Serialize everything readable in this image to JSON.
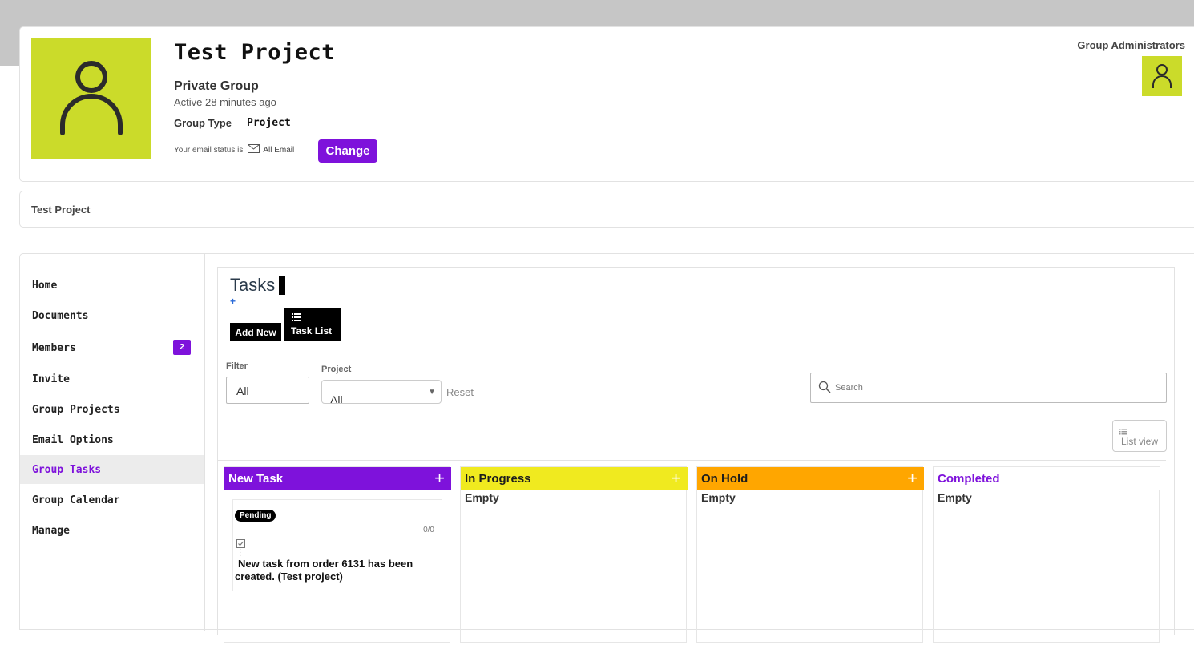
{
  "group": {
    "name": "Test Project",
    "privacy": "Private Group",
    "activity": "Active 28 minutes ago",
    "type_label": "Group Type",
    "type_value": "Project",
    "email_status_prefix": "Your email status is",
    "email_status_value": "All Email",
    "change_label": "Change",
    "admins_label": "Group Administrators"
  },
  "breadcrumb": {
    "current": "Test Project"
  },
  "sidebar": {
    "items": [
      {
        "label": "Home"
      },
      {
        "label": "Documents"
      },
      {
        "label": "Members",
        "badge": "2"
      },
      {
        "label": "Invite"
      },
      {
        "label": "Group Projects"
      },
      {
        "label": "Email Options"
      },
      {
        "label": "Group Tasks",
        "active": true
      },
      {
        "label": "Group Calendar"
      },
      {
        "label": "Manage"
      }
    ]
  },
  "tasks": {
    "title": "Tasks",
    "plus_glyph": "+",
    "add_new_label": "Add New",
    "task_list_label": "Task List",
    "filter_label": "Filter",
    "filter_value": "All",
    "project_label": "Project",
    "project_value": "All",
    "reset_label": "Reset",
    "search_placeholder": "Search",
    "list_view_label": "List view"
  },
  "board": {
    "columns": [
      {
        "title": "New Task",
        "color": "#7e12db",
        "text_color": "#ffffff",
        "plus": "+"
      },
      {
        "title": "In Progress",
        "color": "#f0ea1f",
        "text_color": "#1d1d1d",
        "plus": "+",
        "empty": "Empty"
      },
      {
        "title": "On Hold",
        "color": "#ffa600",
        "text_color": "#1d1d1d",
        "plus": "+",
        "empty": "Empty"
      },
      {
        "title": "Completed",
        "color": "#ffffff",
        "text_color": "#7e12db",
        "empty": "Empty"
      }
    ],
    "card": {
      "status": "Pending",
      "count": "0/0",
      "text": "New task from order 6131 has been created. (Test project)"
    }
  },
  "colors": {
    "accent": "#7e12db",
    "avatar_bg": "#cbdb2a",
    "topbar": "#c6c6c6"
  },
  "icons": {
    "group_avatar": "user-icon",
    "admin_avatar": "user-icon",
    "email": "mail-icon",
    "task_list": "list-icon",
    "search": "search-icon",
    "list_view": "list-icon",
    "checklist": "checkbox-icon",
    "more": "vertical-dots-icon"
  }
}
